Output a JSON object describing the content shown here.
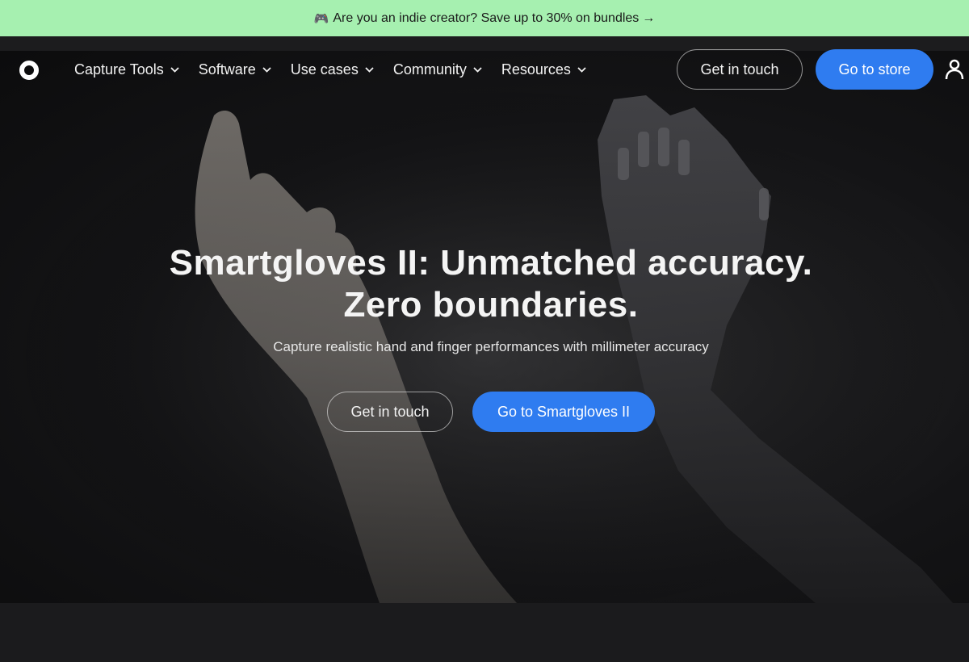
{
  "promo": {
    "emoji": "🎮",
    "text": "Are you an indie creator? Save up to 30% on bundles",
    "arrow": "→"
  },
  "nav": {
    "items": [
      {
        "label": "Capture Tools"
      },
      {
        "label": "Software"
      },
      {
        "label": "Use cases"
      },
      {
        "label": "Community"
      },
      {
        "label": "Resources"
      }
    ],
    "contact_label": "Get in touch",
    "store_label": "Go to store"
  },
  "hero": {
    "title": "Smartgloves II: Unmatched accuracy. Zero boundaries.",
    "subtitle": "Capture realistic hand and finger performances with millimeter accuracy",
    "contact_label": "Get in touch",
    "product_label": "Go to Smartgloves II"
  },
  "colors": {
    "banner": "#a6f0b0",
    "accent": "#2f7cf0",
    "background": "#18181a"
  },
  "icons": {
    "logo": "ring-logo-icon",
    "user": "user-icon",
    "chevron": "chevron-down-icon",
    "gamepad": "gamepad-icon"
  }
}
